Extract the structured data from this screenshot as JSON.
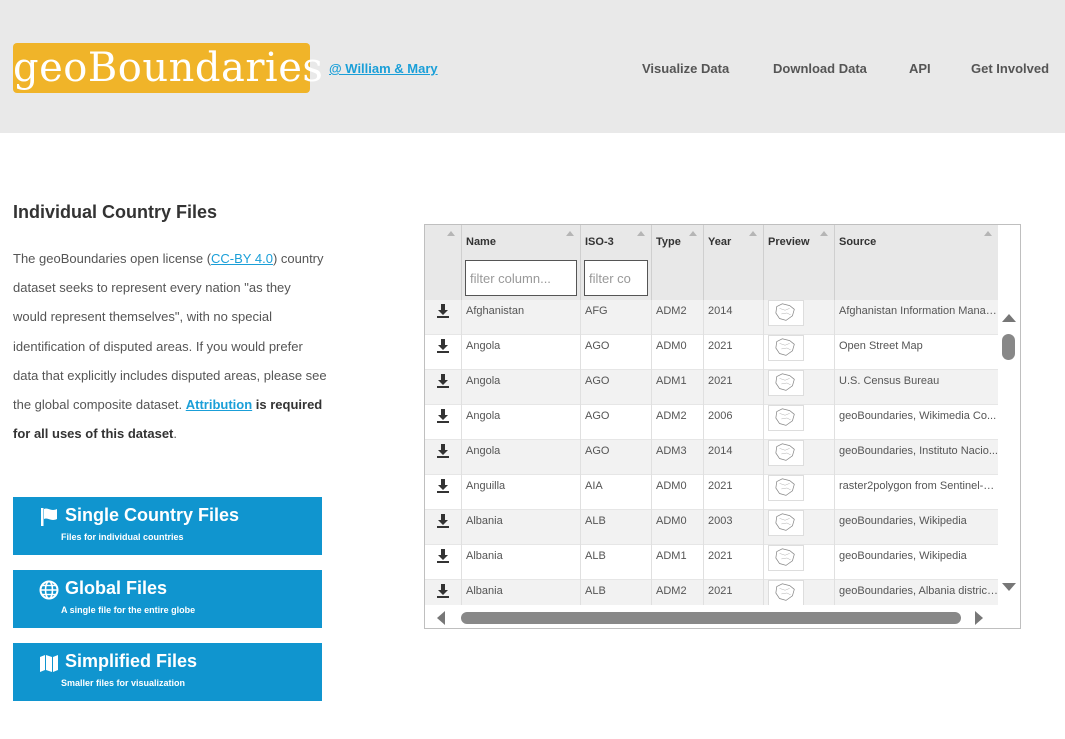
{
  "header": {
    "logo_text": "geoBoundaries",
    "affiliation_link": "@ William & Mary",
    "nav": [
      "Visualize Data",
      "Download Data",
      "API",
      "Get Involved"
    ]
  },
  "main": {
    "title": "Individual Country Files",
    "desc_part1": "The geoBoundaries open license (",
    "license_link": "CC-BY 4.0",
    "desc_part2": ") country dataset seeks to represent every nation \"as they would represent themselves\", with no special identification of disputed areas. If you would prefer data that explicitly includes disputed areas, please see the global composite dataset. ",
    "attribution_link": "Attribution",
    "desc_bold": " is required for all uses of this dataset",
    "desc_end": "."
  },
  "side_buttons": [
    {
      "title": "Single Country Files",
      "subtitle": "Files for individual countries",
      "icon": "flag-icon"
    },
    {
      "title": "Global Files",
      "subtitle": "A single file for the entire globe",
      "icon": "globe-icon"
    },
    {
      "title": "Simplified Files",
      "subtitle": "Smaller files for visualization",
      "icon": "map-icon"
    }
  ],
  "table": {
    "columns": [
      "Name",
      "ISO-3",
      "Type",
      "Year",
      "Preview",
      "Source"
    ],
    "name_filter_placeholder": "filter column...",
    "iso_filter_placeholder": "filter co",
    "rows": [
      {
        "name": "Afghanistan",
        "iso": "AFG",
        "type": "ADM2",
        "year": "2014",
        "source": "Afghanistan Information Manag..."
      },
      {
        "name": "Angola",
        "iso": "AGO",
        "type": "ADM0",
        "year": "2021",
        "source": "Open Street Map"
      },
      {
        "name": "Angola",
        "iso": "AGO",
        "type": "ADM1",
        "year": "2021",
        "source": "U.S. Census Bureau"
      },
      {
        "name": "Angola",
        "iso": "AGO",
        "type": "ADM2",
        "year": "2006",
        "source": "geoBoundaries, Wikimedia Co..."
      },
      {
        "name": "Angola",
        "iso": "AGO",
        "type": "ADM3",
        "year": "2014",
        "source": "geoBoundaries, Instituto Nacio..."
      },
      {
        "name": "Anguilla",
        "iso": "AIA",
        "type": "ADM0",
        "year": "2021",
        "source": "raster2polygon from Sentinel-2..."
      },
      {
        "name": "Albania",
        "iso": "ALB",
        "type": "ADM0",
        "year": "2003",
        "source": "geoBoundaries, Wikipedia"
      },
      {
        "name": "Albania",
        "iso": "ALB",
        "type": "ADM1",
        "year": "2021",
        "source": "geoBoundaries, Wikipedia"
      },
      {
        "name": "Albania",
        "iso": "ALB",
        "type": "ADM2",
        "year": "2021",
        "source": "geoBoundaries, Albania district..."
      }
    ]
  },
  "colors": {
    "logo": "#f0b429",
    "button": "#1095cf",
    "link": "#1a9fd8"
  }
}
